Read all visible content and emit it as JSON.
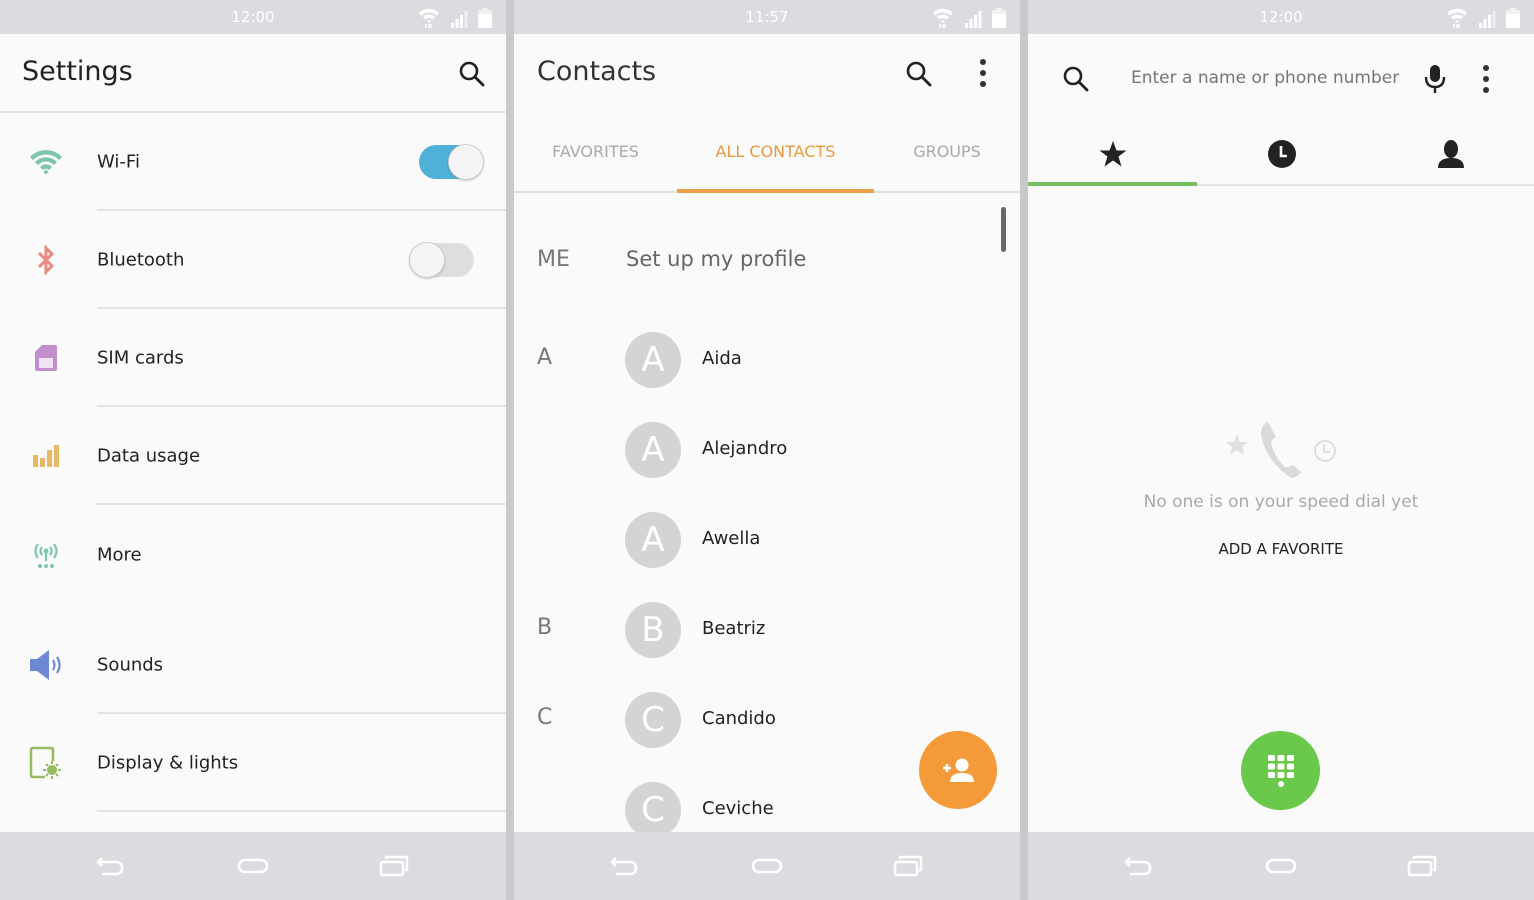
{
  "colors": {
    "wifi_icon": "#7cc6ae",
    "bluetooth_icon": "#ea8a80",
    "sim_icon": "#c18fce",
    "data_usage_icon": "#e5b965",
    "more_icon": "#7cc6ae",
    "sounds_icon": "#6e88d6",
    "display_icon": "#95bb5e",
    "toggle_on": "#4fb0d8",
    "contacts_accent": "#eda04a",
    "phone_accent": "#6ac84b"
  },
  "settings": {
    "status": {
      "time": "12:00"
    },
    "title": "Settings",
    "search_icon": "search-icon",
    "items": [
      {
        "label": "Wi-Fi",
        "icon": "wifi-icon",
        "toggle": true,
        "toggle_on": true
      },
      {
        "label": "Bluetooth",
        "icon": "bluetooth-icon",
        "toggle": true,
        "toggle_on": false
      },
      {
        "label": "SIM cards",
        "icon": "sim-card-icon"
      },
      {
        "label": "Data usage",
        "icon": "data-usage-icon"
      },
      {
        "label": "More",
        "icon": "antenna-icon"
      },
      {
        "label": "Sounds",
        "icon": "speaker-icon"
      },
      {
        "label": "Display & lights",
        "icon": "display-icon"
      }
    ]
  },
  "contacts": {
    "status": {
      "time": "11:57"
    },
    "title": "Contacts",
    "tabs": [
      {
        "label": "FAVORITES",
        "active": false
      },
      {
        "label": "ALL CONTACTS",
        "active": true
      },
      {
        "label": "GROUPS",
        "active": false
      }
    ],
    "me": {
      "label": "ME",
      "text": "Set up my profile"
    },
    "list": [
      {
        "index": "A",
        "initial": "A",
        "name": "Aida"
      },
      {
        "index": "",
        "initial": "A",
        "name": "Alejandro"
      },
      {
        "index": "",
        "initial": "A",
        "name": "Awella"
      },
      {
        "index": "B",
        "initial": "B",
        "name": "Beatriz"
      },
      {
        "index": "C",
        "initial": "C",
        "name": "Candido"
      },
      {
        "index": "",
        "initial": "C",
        "name": "Ceviche"
      }
    ],
    "fab_icon": "add-contact-icon"
  },
  "phone": {
    "status": {
      "time": "12:00"
    },
    "search": {
      "placeholder": "Enter a name or phone number",
      "value": ""
    },
    "tabs": [
      {
        "icon": "star-icon",
        "active": true
      },
      {
        "icon": "recents-clock-icon",
        "active": false
      },
      {
        "icon": "contacts-person-icon",
        "active": false
      }
    ],
    "empty_message": "No one is on your speed dial yet",
    "add_favorite": "ADD A FAVORITE",
    "fab_icon": "dialpad-icon"
  }
}
